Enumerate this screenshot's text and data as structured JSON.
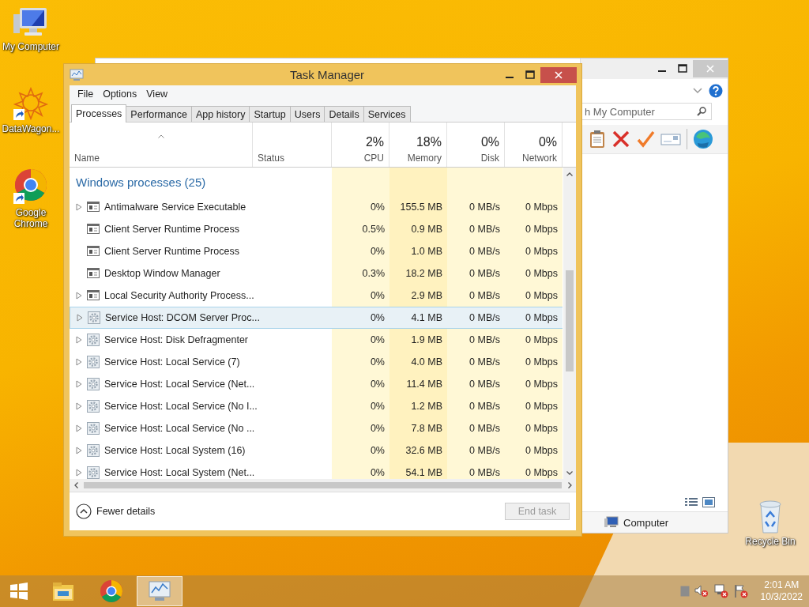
{
  "desktop_icons": [
    {
      "label": "My Computer",
      "kind": "computer"
    },
    {
      "label": "DataWagon...",
      "kind": "datawagon"
    },
    {
      "label": "Google Chrome",
      "kind": "chrome"
    },
    {
      "label": "Recycle Bin",
      "kind": "bin"
    }
  ],
  "background_window": {
    "search": {
      "placeholder": "h My Computer"
    },
    "status_text": "Computer"
  },
  "task_manager": {
    "title": "Task Manager",
    "menu": [
      "File",
      "Options",
      "View"
    ],
    "tabs": [
      {
        "label": "Processes",
        "selected": true
      },
      {
        "label": "Performance",
        "selected": false
      },
      {
        "label": "App history",
        "selected": false
      },
      {
        "label": "Startup",
        "selected": false
      },
      {
        "label": "Users",
        "selected": false
      },
      {
        "label": "Details",
        "selected": false
      },
      {
        "label": "Services",
        "selected": false
      }
    ],
    "columns": [
      {
        "label": "Name",
        "sorted": true
      },
      {
        "label": "Status",
        "sorted": false
      },
      {
        "label": "CPU",
        "total": "2%",
        "sorted": false
      },
      {
        "label": "Memory",
        "total": "18%",
        "sorted": false
      },
      {
        "label": "Disk",
        "total": "0%",
        "sorted": false
      },
      {
        "label": "Network",
        "total": "0%",
        "sorted": false
      }
    ],
    "group": "Windows processes (25)",
    "rows": [
      {
        "name": "Antimalware Service Executable",
        "kind": "app",
        "expandable": true,
        "selected": false,
        "cpu": "0%",
        "memory": "155.5 MB",
        "disk": "0 MB/s",
        "network": "0 Mbps"
      },
      {
        "name": "Client Server Runtime Process",
        "kind": "app",
        "expandable": false,
        "selected": false,
        "cpu": "0.5%",
        "memory": "0.9 MB",
        "disk": "0 MB/s",
        "network": "0 Mbps"
      },
      {
        "name": "Client Server Runtime Process",
        "kind": "app",
        "expandable": false,
        "selected": false,
        "cpu": "0%",
        "memory": "1.0 MB",
        "disk": "0 MB/s",
        "network": "0 Mbps"
      },
      {
        "name": "Desktop Window Manager",
        "kind": "app",
        "expandable": false,
        "selected": false,
        "cpu": "0.3%",
        "memory": "18.2 MB",
        "disk": "0 MB/s",
        "network": "0 Mbps"
      },
      {
        "name": "Local Security Authority Process...",
        "kind": "app",
        "expandable": true,
        "selected": false,
        "cpu": "0%",
        "memory": "2.9 MB",
        "disk": "0 MB/s",
        "network": "0 Mbps"
      },
      {
        "name": "Service Host: DCOM Server Proc...",
        "kind": "service",
        "expandable": true,
        "selected": true,
        "cpu": "0%",
        "memory": "4.1 MB",
        "disk": "0 MB/s",
        "network": "0 Mbps"
      },
      {
        "name": "Service Host: Disk Defragmenter",
        "kind": "service",
        "expandable": true,
        "selected": false,
        "cpu": "0%",
        "memory": "1.9 MB",
        "disk": "0 MB/s",
        "network": "0 Mbps"
      },
      {
        "name": "Service Host: Local Service (7)",
        "kind": "service",
        "expandable": true,
        "selected": false,
        "cpu": "0%",
        "memory": "4.0 MB",
        "disk": "0 MB/s",
        "network": "0 Mbps"
      },
      {
        "name": "Service Host: Local Service (Net...",
        "kind": "service",
        "expandable": true,
        "selected": false,
        "cpu": "0%",
        "memory": "11.4 MB",
        "disk": "0 MB/s",
        "network": "0 Mbps"
      },
      {
        "name": "Service Host: Local Service (No I...",
        "kind": "service",
        "expandable": true,
        "selected": false,
        "cpu": "0%",
        "memory": "1.2 MB",
        "disk": "0 MB/s",
        "network": "0 Mbps"
      },
      {
        "name": "Service Host: Local Service (No ...",
        "kind": "service",
        "expandable": true,
        "selected": false,
        "cpu": "0%",
        "memory": "7.8 MB",
        "disk": "0 MB/s",
        "network": "0 Mbps"
      },
      {
        "name": "Service Host: Local System (16)",
        "kind": "service",
        "expandable": true,
        "selected": false,
        "cpu": "0%",
        "memory": "32.6 MB",
        "disk": "0 MB/s",
        "network": "0 Mbps"
      },
      {
        "name": "Service Host: Local System (Net...",
        "kind": "service",
        "expandable": true,
        "selected": false,
        "cpu": "0%",
        "memory": "54.1 MB",
        "disk": "0 MB/s",
        "network": "0 Mbps"
      }
    ],
    "fewer_details": "Fewer details",
    "end_task": {
      "label": "End task",
      "disabled": true
    }
  },
  "taskbar": {
    "apps": [
      {
        "kind": "explorer",
        "active": false
      },
      {
        "kind": "chrome",
        "active": false
      },
      {
        "kind": "taskmgr",
        "active": true
      }
    ],
    "time": "2:01 AM",
    "date": "10/3/2022"
  }
}
